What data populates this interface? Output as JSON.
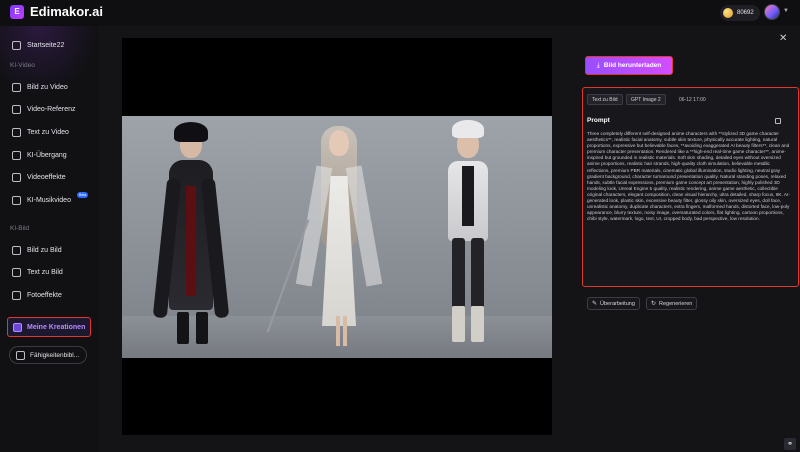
{
  "app": {
    "title": "Edimakor.ai",
    "logo_glyph": "E"
  },
  "header": {
    "credits": "80692"
  },
  "sidebar": {
    "home": "Startseite22",
    "section_video": "KI-Video",
    "video_items": [
      "Bild zu Video",
      "Video-Referenz",
      "Text zu Video",
      "KI-Übergang",
      "Videoeffekte",
      "KI-Musikvideo"
    ],
    "beta_badge": "Beta",
    "section_image": "KI-Bild",
    "image_items": [
      "Bild zu Bild",
      "Text zu Bild",
      "Fotoeffekte"
    ],
    "my_creations": "Meine Kreationen",
    "skills": "Fähigkeitenbibl..."
  },
  "panel": {
    "download_label": "Bild herunterladen",
    "chip_type": "Text zu Bild",
    "chip_model": "GPT Image 2",
    "date": "06-12 17:00",
    "prompt_title": "Prompt",
    "prompt_text": "Three completely different self-designed anime characters with **stylized 3D game character aesthetics**, realistic facial anatomy, subtle skin texture, physically accurate lighting, natural proportions, expressive but believable faces, **avoiding exaggerated AI beauty filters**, clean and premium character presentation. Rendered like a **high-end real-time game character**, anime-inspired but grounded in realistic materials. Soft skin shading, detailed eyes without oversized anime proportions, realistic hair strands, high-quality cloth simulation, believable metallic reflections, premium PBR materials, cinematic global illumination, studio lighting, neutral gray gradient background, character turnaround presentation quality. Natural standing poses, relaxed hands, subtle facial expressions, premium game concept art presentation, highly polished 3D modeling look, Unreal Engine 5 quality, realistic rendering, anime game aesthetic, collectible original characters, elegant composition, clean visual hierarchy, ultra detailed, sharp focus, 8K. AI-generated look, plastic skin, excessive beauty filter, glossy oily skin, oversized eyes, doll face, unrealistic anatomy, duplicate characters, extra fingers, malformed hands, distorted face, low-poly appearance, blurry texture, noisy image, oversaturated colors, flat lighting, cartoon proportions, chibi style, watermark, logo, text, UI, cropped body, bad perspective, low resolution.",
    "edit_label": "Überarbeitung",
    "regen_label": "Regenerieren"
  },
  "icons": {
    "close": "close-icon",
    "download": "download-icon",
    "copy": "copy-icon",
    "edit": "edit-icon",
    "regenerate": "refresh-icon",
    "corner": "link-icon"
  },
  "colors": {
    "accent": "#a64dff",
    "highlight_border": "#e0382f",
    "beta": "#2f6bff"
  }
}
